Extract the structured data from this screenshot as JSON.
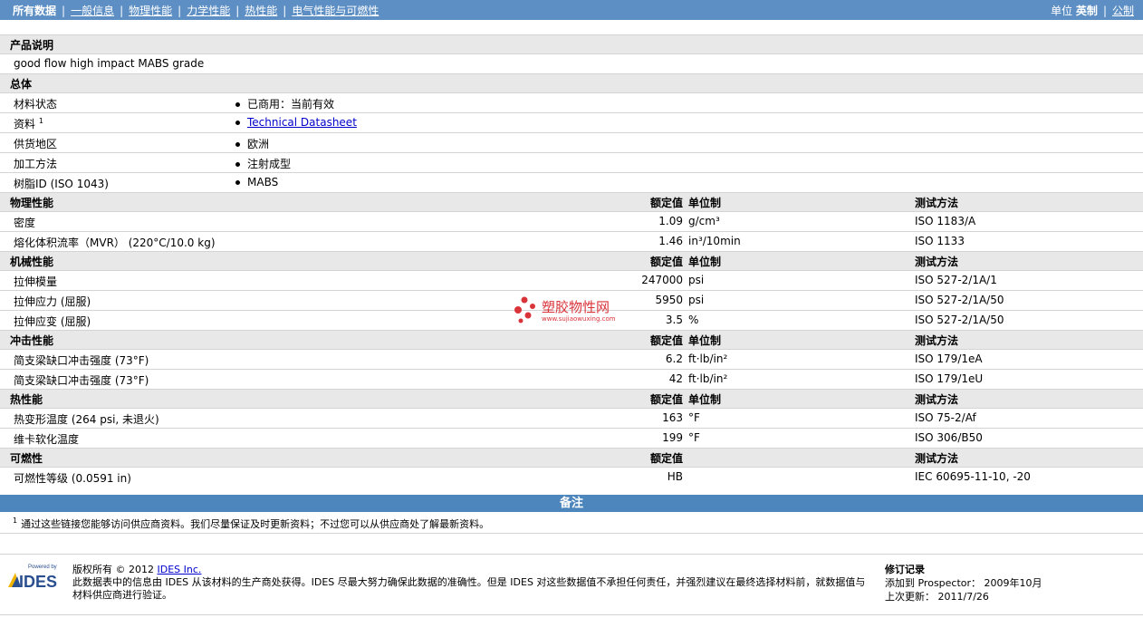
{
  "nav": {
    "items": [
      "所有数据",
      "一般信息",
      "物理性能",
      "力学性能",
      "热性能",
      "电气性能与可燃性"
    ],
    "units_label": "单位",
    "units_imperial": "英制",
    "units_metric": "公制"
  },
  "product": {
    "header": "产品说明",
    "description": "good flow high impact MABS grade"
  },
  "general": {
    "header": "总体",
    "rows": [
      {
        "label": "材料状态",
        "value": "已商用：当前有效"
      },
      {
        "label": "资料",
        "sup": "1",
        "value": "Technical Datasheet"
      },
      {
        "label": "供货地区",
        "value": "欧洲"
      },
      {
        "label": "加工方法",
        "value": "注射成型"
      },
      {
        "label": "树脂ID (ISO 1043)",
        "value": "MABS"
      }
    ]
  },
  "columns": {
    "nominal": "额定值",
    "unit": "单位制",
    "test": "测试方法"
  },
  "physical": {
    "header": "物理性能",
    "rows": [
      {
        "label": "密度",
        "value": "1.09",
        "unit": "g/cm³",
        "test": "ISO 1183/A"
      },
      {
        "label": "熔化体积流率（MVR） (220°C/10.0 kg)",
        "value": "1.46",
        "unit": "in³/10min",
        "test": "ISO 1133"
      }
    ]
  },
  "mechanical": {
    "header": "机械性能",
    "rows": [
      {
        "label": "拉伸模量",
        "value": "247000",
        "unit": "psi",
        "test": "ISO 527-2/1A/1"
      },
      {
        "label": "拉伸应力 (屈服)",
        "value": "5950",
        "unit": "psi",
        "test": "ISO 527-2/1A/50"
      },
      {
        "label": "拉伸应变 (屈服)",
        "value": "3.5",
        "unit": "%",
        "test": "ISO 527-2/1A/50"
      }
    ]
  },
  "impact": {
    "header": "冲击性能",
    "rows": [
      {
        "label": "简支梁缺口冲击强度 (73°F)",
        "value": "6.2",
        "unit": "ft·lb/in²",
        "test": "ISO 179/1eA"
      },
      {
        "label": "简支梁缺口冲击强度 (73°F)",
        "value": "42",
        "unit": "ft·lb/in²",
        "test": "ISO 179/1eU"
      }
    ]
  },
  "thermal": {
    "header": "热性能",
    "rows": [
      {
        "label": "热变形温度 (264 psi, 未退火)",
        "value": "163",
        "unit": "°F",
        "test": "ISO 75-2/Af"
      },
      {
        "label": "维卡软化温度",
        "value": "199",
        "unit": "°F",
        "test": "ISO 306/B50"
      }
    ]
  },
  "flammability": {
    "header": "可燃性",
    "rows": [
      {
        "label": "可燃性等级 (0.0591 in)",
        "value": "HB",
        "unit": "",
        "test": "IEC 60695-11-10, -20"
      }
    ]
  },
  "notes": {
    "header": "备注",
    "sup": "1",
    "text": "通过这些链接您能够访问供应商资料。我们尽量保证及时更新资料；不过您可以从供应商处了解最新资料。"
  },
  "watermark": {
    "brand": "塑胶物性网",
    "url": "www.sujiaowuxing.com"
  },
  "footer": {
    "logo_powered": "Powered by",
    "logo_text": "IDES",
    "copyright": "版权所有 © 2012",
    "company_link": "IDES Inc.",
    "disclaimer": "此数据表中的信息由 IDES 从该材料的生产商处获得。IDES 尽最大努力确保此数据的准确性。但是 IDES 对这些数据值不承担任何责任，并强烈建议在最终选择材料前，就数据值与材料供应商进行验证。",
    "rev_title": "修订记录",
    "rev_added": "添加到 Prospector： 2009年10月",
    "rev_updated": "上次更新： 2011/7/26"
  },
  "colors": {
    "nav_bg": "#5d8fc4",
    "notes_bg": "#4d86bd",
    "section_bg": "#e8e8e8",
    "watermark": "#d9343a"
  }
}
